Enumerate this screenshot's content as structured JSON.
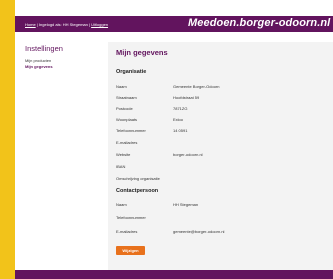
{
  "header": {
    "breadcrumb": {
      "home": "Home",
      "sep1": " | ",
      "middle": "Ingelogd als: HH Stegeman",
      "sep2": " | ",
      "logout": "Uitloggen"
    },
    "brand": "Meedoen.borger-odoorn.nl"
  },
  "sidebar": {
    "title": "Instellingen",
    "items": [
      {
        "label": "Mijn producten"
      },
      {
        "label": "Mijn gegevens"
      }
    ]
  },
  "main": {
    "title": "Mijn gegevens",
    "organisatie": {
      "heading": "Organisatie",
      "rows": [
        {
          "label": "Naam",
          "value": "Gemeente Borger-Odoorn"
        },
        {
          "label": "Straatnaam",
          "value": "Hoofdstraat 59"
        },
        {
          "label": "Postcode",
          "value": "7871ZG"
        },
        {
          "label": "Woonplaats",
          "value": "Exloo"
        },
        {
          "label": "Telefoonnummer",
          "value": "14 0591"
        },
        {
          "label": "E-mailadres",
          "value": ""
        },
        {
          "label": "Website",
          "value": "borger-odoorn.nl"
        },
        {
          "label": "IBAN",
          "value": ""
        },
        {
          "label": "Omschrijving organisatie",
          "value": ""
        }
      ]
    },
    "contactpersoon": {
      "heading": "Contactpersoon",
      "rows": [
        {
          "label": "Naam",
          "value": "HH Stegeman"
        },
        {
          "label": "Telefoonnummer",
          "value": ""
        },
        {
          "label": "E-mailadres",
          "value": "gemeente@borger-odoorn.nl"
        }
      ]
    },
    "button_label": "Wijzigen"
  },
  "colors": {
    "brand_purple": "#62145e",
    "background_yellow": "#f2c31a",
    "button_orange": "#e8711c"
  }
}
